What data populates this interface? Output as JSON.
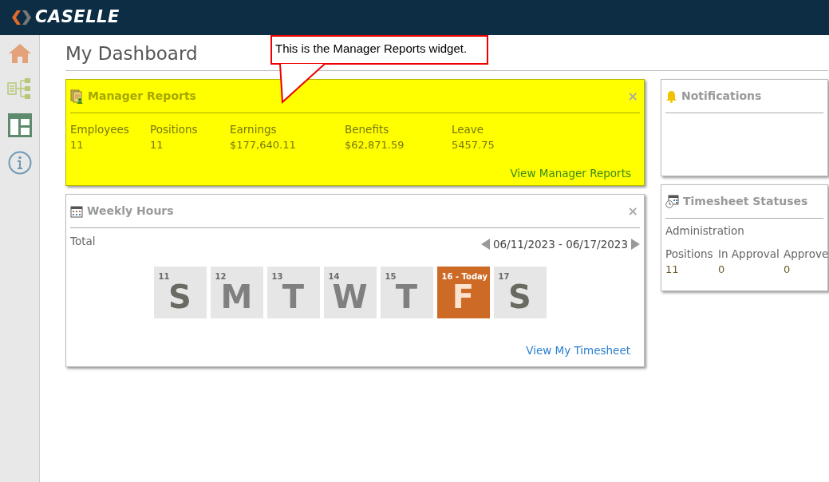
{
  "brand": {
    "name": "CASELLE"
  },
  "sidebar": {
    "items": [
      {
        "kind": "home"
      },
      {
        "kind": "tree"
      },
      {
        "kind": "layout"
      },
      {
        "kind": "info"
      }
    ]
  },
  "page": {
    "title": "My Dashboard"
  },
  "callout": {
    "text": "This is the Manager Reports widget."
  },
  "manager_reports": {
    "title": "Manager Reports",
    "close": "×",
    "highlighted": true,
    "stats": [
      {
        "label": "Employees",
        "value": "11"
      },
      {
        "label": "Positions",
        "value": "11"
      },
      {
        "label": "Earnings",
        "value": "$177,640.11"
      },
      {
        "label": "Benefits",
        "value": "$62,871.59"
      },
      {
        "label": "Leave",
        "value": "5457.75"
      }
    ],
    "link": "View Manager Reports"
  },
  "weekly_hours": {
    "title": "Weekly Hours",
    "close": "×",
    "total_label": "Total",
    "date_range": "06/11/2023 - 06/17/2023",
    "days": [
      {
        "number": "11",
        "letter": "S",
        "weekend": true,
        "selected": false
      },
      {
        "number": "12",
        "letter": "M",
        "weekend": false,
        "selected": false
      },
      {
        "number": "13",
        "letter": "T",
        "weekend": false,
        "selected": false
      },
      {
        "number": "14",
        "letter": "W",
        "weekend": false,
        "selected": false
      },
      {
        "number": "15",
        "letter": "T",
        "weekend": false,
        "selected": false
      },
      {
        "number": "16 - Today",
        "letter": "F",
        "weekend": false,
        "selected": true
      },
      {
        "number": "17",
        "letter": "S",
        "weekend": true,
        "selected": false
      }
    ],
    "link": "View My Timesheet"
  },
  "notifications": {
    "title": "Notifications"
  },
  "timesheet_statuses": {
    "title": "Timesheet Statuses",
    "department": "Administration",
    "stats": [
      {
        "label": "Positions",
        "value": "11"
      },
      {
        "label": "In Approval",
        "value": "0"
      },
      {
        "label": "Approve",
        "value": "0"
      }
    ]
  }
}
